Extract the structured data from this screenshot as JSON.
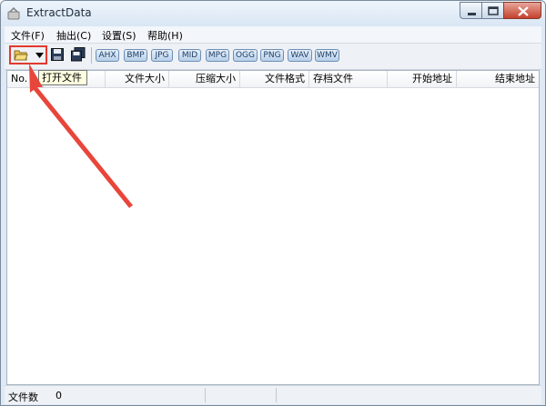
{
  "window": {
    "title": "ExtractData"
  },
  "menu": [
    "文件(F)",
    "抽出(C)",
    "设置(S)",
    "帮助(H)"
  ],
  "toolbar": {
    "formats": [
      "AHX",
      "BMP",
      "JPG",
      "MID",
      "MPG",
      "OGG",
      "PNG",
      "WAV",
      "WMV"
    ],
    "tooltip": "打开文件"
  },
  "list": {
    "columns": [
      "No.",
      "",
      "文件大小",
      "压缩大小",
      "文件格式",
      "存档文件",
      "开始地址",
      "结束地址"
    ]
  },
  "status": {
    "label": "文件数",
    "count": "0"
  },
  "colors": {
    "highlight": "#e23a2e",
    "arrow": "#e8463a"
  }
}
